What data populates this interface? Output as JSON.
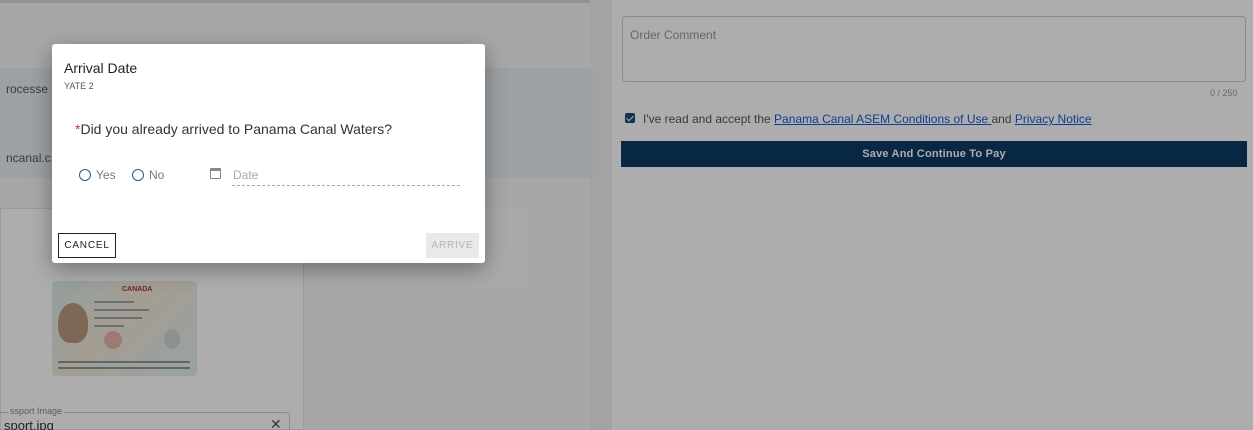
{
  "background": {
    "info_text_1": "rocesse",
    "info_text_2": "ncanal.c",
    "passport": {
      "header": "CANADA"
    },
    "passport_field": {
      "label": "ssport Image",
      "value": "sport.jpg"
    },
    "order_comment": {
      "placeholder": "Order Comment",
      "counter": "0 / 250"
    },
    "terms": {
      "prefix": "I've read and accept the ",
      "link_1": "Panama Canal ASEM Conditions of Use ",
      "middle": "and ",
      "link_2": "Privacy Notice",
      "checked": true
    },
    "pay_button": "Save And Continue To Pay"
  },
  "dialog": {
    "title": "Arrival Date",
    "subtitle": "YATE 2",
    "question_required_mark": "*",
    "question": "Did you already arrived to Panama Canal Waters?",
    "options": {
      "yes": "Yes",
      "no": "No"
    },
    "date_placeholder": "Date",
    "cancel_label": "CANCEL",
    "arrive_label": "ARRIVE"
  },
  "colors": {
    "primary": "#0b3a66",
    "link": "#1a5bd6",
    "required": "#c0392b",
    "checkbox": "#1c4a7a"
  }
}
